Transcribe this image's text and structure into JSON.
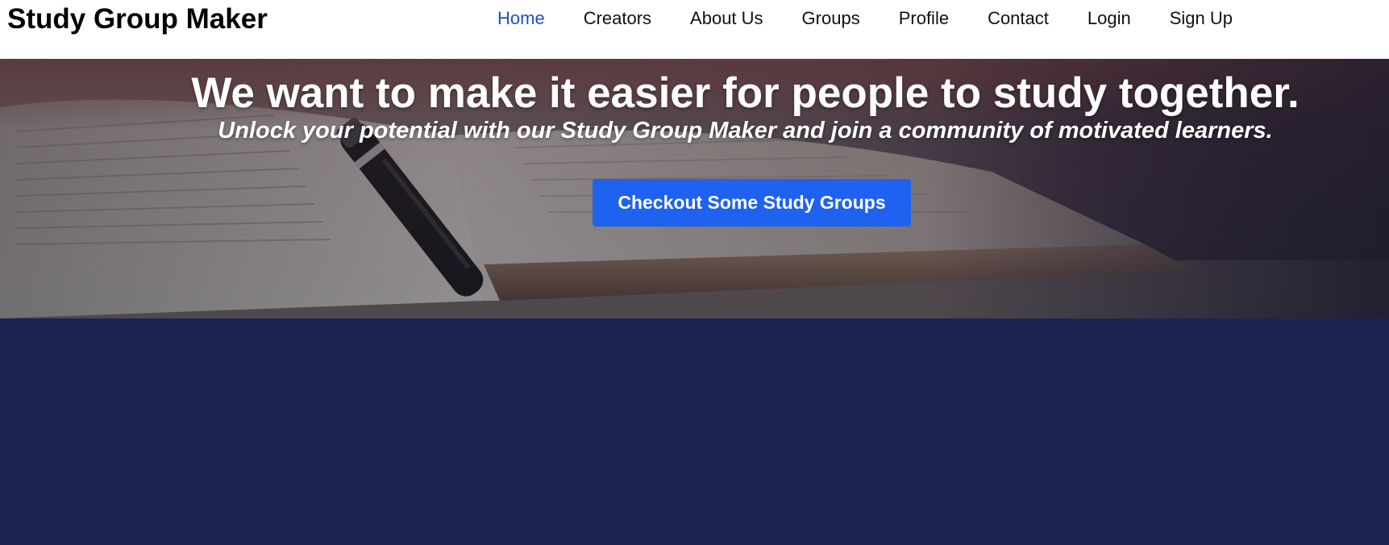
{
  "brand": {
    "title": "Study Group Maker"
  },
  "nav": {
    "items": [
      {
        "label": "Home",
        "active": true
      },
      {
        "label": "Creators"
      },
      {
        "label": "About Us"
      },
      {
        "label": "Groups"
      },
      {
        "label": "Profile"
      },
      {
        "label": "Contact"
      },
      {
        "label": "Login"
      },
      {
        "label": "Sign Up"
      }
    ]
  },
  "hero": {
    "title": "We want to make it easier for people to study together.",
    "subtitle": "Unlock your potential with our Study Group Maker and join a community of motivated learners.",
    "cta_label": "Checkout Some Study Groups",
    "background_image": "open-book-with-pen"
  },
  "colors": {
    "nav_active": "#1b4fd6",
    "button": "#1f62f0",
    "page_background": "#1b2550"
  }
}
